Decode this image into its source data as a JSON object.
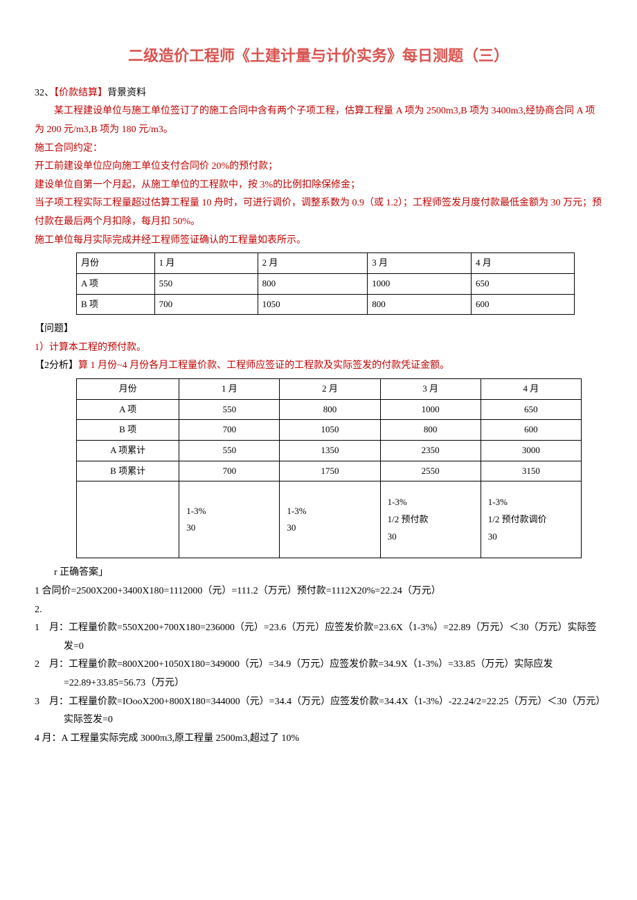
{
  "title": "二级造价工程师《土建计量与计价实务》每日测题（三）",
  "q32_label": "32、【价款结算】背景资料",
  "bg_p1": "某工程建设单位与施工单位签订了的施工合同中含有两个子项工程，估算工程量 A 项为 2500m3,B 项为 3400m3,经协商合同 A 项为 200 元/m3,B 项为 180 元/m3。",
  "bg_p2": "施工合同约定：",
  "bg_p3": "开工前建设单位应向施工单位支付合同价 20%的预付款；",
  "bg_p4": "建设单位自第一个月起，从施工单位的工程款中，按 3%的比例扣除保修金；",
  "bg_p5": "当子项工程实际工程量超过估算工程量 10 舟时，可进行调价，调整系数为 0.9（或 1.2）；工程师签发月度付款最低金额为 30 万元；预付款在最后两个月扣除，每月扣 50%。",
  "bg_p6": "施工单位每月实际完成并经工程师签证确认的工程量如表所示。",
  "table1": {
    "headers": [
      "月份",
      "1 月",
      "2 月",
      "3 月",
      "4 月"
    ],
    "rows": [
      [
        "A 项",
        "550",
        "800",
        "1000",
        "650"
      ],
      [
        "B 项",
        "700",
        "1050",
        "800",
        "600"
      ]
    ]
  },
  "wt_label": "【问题】",
  "wt_1": "1）计算本工程的预付款。",
  "wt_2_prefix": "【2分析】",
  "wt_2_suffix": "算 1 月份~4 月份各月工程量价款、工程师应签证的工程款及实际签发的付款凭证金额。",
  "table2": {
    "headers": [
      "月份",
      "1 月",
      "2 月",
      "3 月",
      "4 月"
    ],
    "rows": [
      [
        "A 项",
        "550",
        "800",
        "1000",
        "650"
      ],
      [
        "B 项",
        "700",
        "1050",
        "800",
        "600"
      ],
      [
        "A 项累计",
        "550",
        "1350",
        "2350",
        "3000"
      ],
      [
        "B 项累计",
        "700",
        "1750",
        "2550",
        "3150"
      ]
    ],
    "tall": [
      "",
      "1-3%\n30",
      "1-3%\n30",
      "1-3%\n1/2 预付款\n30",
      "1-3%\n1/2 预付款调价\n30"
    ]
  },
  "ans_label": "r 正确答案」",
  "ans_1": "1 合同价=2500X200+3400X180=1112000（元）=111.2（万元）预付款=1112X20%=22.24（万元）",
  "ans_2": "2.",
  "ans_m1": "1　月：工程量价款=550X200+700X180=236000（元）=23.6（万元）应签发价款=23.6X（1-3%）=22.89（万元）＜30（万元）实际签发=0",
  "ans_m2": "2　月：工程量价款=800X200+1050X180=349000（元）=34.9（万元）应签发价款=34.9X（1-3%）=33.85（万元）实际应发=22.89+33.85=56.73（万元）",
  "ans_m3": "3　月：工程量价款=IOooX200+800X180=344000（元）=34.4（万元）应签发价款=34.4X（1-3%）-22.24/2=22.25（万元）＜30（万元）实际签发=0",
  "ans_m4": "4 月：A 工程量实际完成 3000πι3,原工程量 2500m3,超过了 10%"
}
